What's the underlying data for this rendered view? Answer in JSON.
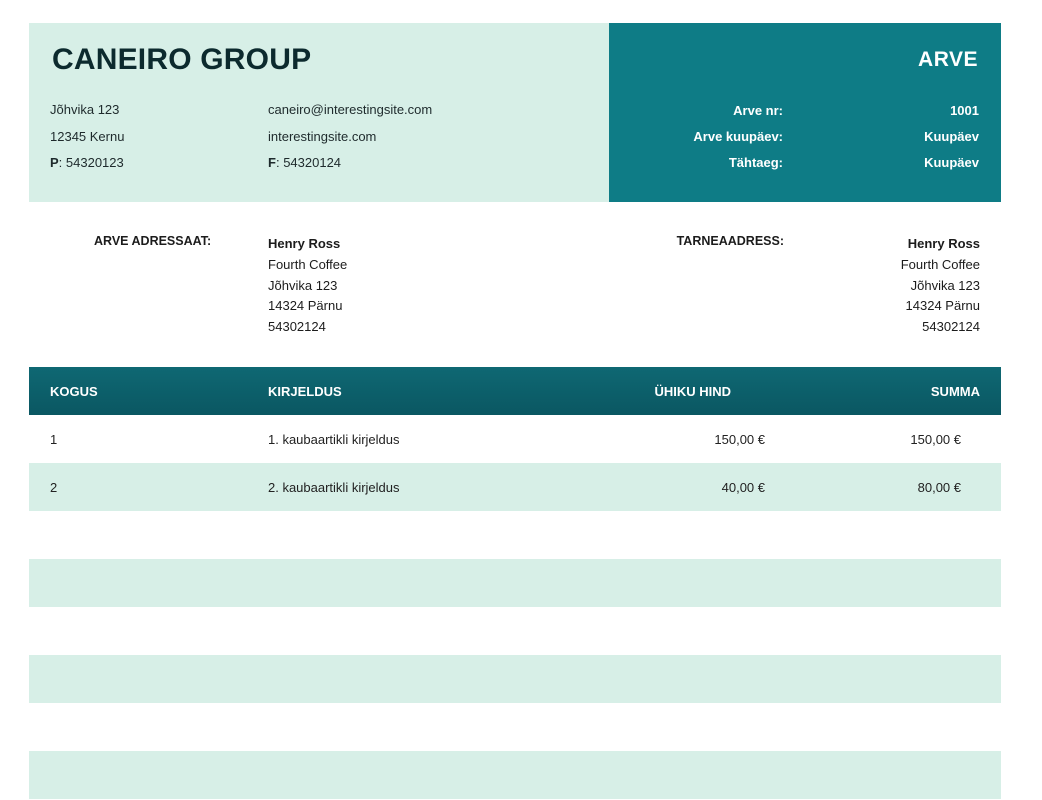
{
  "company": {
    "name": "CANEIRO GROUP",
    "address_line1": "Jõhvika 123",
    "address_line2": "12345 Kernu",
    "phone_label": "P",
    "phone": "54320123",
    "email": "caneiro@interestingsite.com",
    "website": "interestingsite.com",
    "fax_label": "F",
    "fax": "54320124"
  },
  "invoice": {
    "title": "ARVE",
    "meta": [
      {
        "label": "Arve nr:",
        "value": "1001"
      },
      {
        "label": "Arve kuupäev:",
        "value": "Kuupäev"
      },
      {
        "label": "Tähtaeg:",
        "value": "Kuupäev"
      }
    ]
  },
  "bill_to": {
    "label": "ARVE ADRESSAAT:",
    "name": "Henry Ross",
    "company": "Fourth Coffee",
    "street": "Jõhvika 123",
    "city": "14324 Pärnu",
    "phone": "54302124"
  },
  "ship_to": {
    "label": "TARNEAADRESS:",
    "name": "Henry Ross",
    "company": "Fourth Coffee",
    "street": "Jõhvika 123",
    "city": "14324 Pärnu",
    "phone": "54302124"
  },
  "table": {
    "headers": {
      "qty": "KOGUS",
      "desc": "KIRJELDUS",
      "unit_price": "ÜHIKU HIND",
      "total": "SUMMA"
    },
    "rows": [
      {
        "qty": "1",
        "desc": "1. kaubaartikli kirjeldus",
        "unit_price": "150,00 €",
        "total": "150,00 €"
      },
      {
        "qty": "2",
        "desc": "2. kaubaartikli kirjeldus",
        "unit_price": "40,00 €",
        "total": "80,00 €"
      },
      {
        "qty": "",
        "desc": "",
        "unit_price": "",
        "total": ""
      },
      {
        "qty": "",
        "desc": "",
        "unit_price": "",
        "total": ""
      },
      {
        "qty": "",
        "desc": "",
        "unit_price": "",
        "total": ""
      },
      {
        "qty": "",
        "desc": "",
        "unit_price": "",
        "total": ""
      },
      {
        "qty": "",
        "desc": "",
        "unit_price": "",
        "total": ""
      },
      {
        "qty": "",
        "desc": "",
        "unit_price": "",
        "total": ""
      }
    ]
  },
  "colors": {
    "header_light": "#d7efe7",
    "header_dark": "#0e7c86",
    "table_head": "#0a5762",
    "stripe": "#d7efe7"
  }
}
